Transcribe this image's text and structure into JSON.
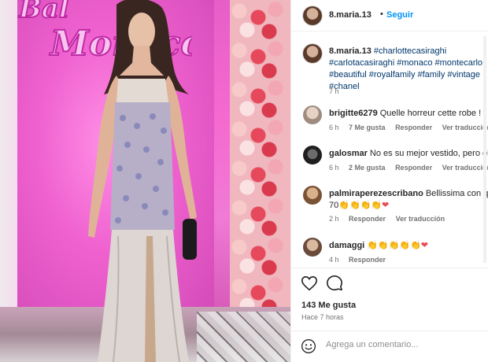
{
  "photo": {
    "sign_text": "Bal de la Rose Monaco",
    "alt": ""
  },
  "header": {
    "username": "8.maria.13",
    "separator": "•",
    "follow_label": "Seguir"
  },
  "caption": {
    "username": "8.maria.13",
    "hashtags": "#charlottecasiraghi #carlotacasiraghi #monaco #montecarlo #beautiful #royalfamily #family #vintage #chanel",
    "time": "7 h"
  },
  "comments": [
    {
      "username": "brigitte6279",
      "text": "Quelle horreur cette robe !",
      "time": "6 h",
      "likes": "7 Me gusta",
      "reply": "Responder",
      "translate": "Ver traducción"
    },
    {
      "username": "galosmar",
      "text": "No es su mejor vestido, pero el",
      "time": "6 h",
      "likes": "2 Me gusta",
      "reply": "Responder",
      "translate": "Ver traducción"
    },
    {
      "username": "palmiraperezescribano",
      "text": "Bellissima con que",
      "text2": "70",
      "time": "2 h",
      "likes": "",
      "reply": "Responder",
      "translate": "Ver traducción"
    },
    {
      "username": "damaggi",
      "text": "",
      "time": "4 h",
      "likes": "",
      "reply": "Responder",
      "translate": ""
    }
  ],
  "actions": {
    "like_icon": "heart-icon",
    "comment_icon": "comment-icon",
    "likes_count": "143 Me gusta",
    "posted_ago": "Hace 7 horas"
  },
  "composer": {
    "emoji_icon": "emoji-icon",
    "placeholder": "Agrega un comentario..."
  },
  "colors": {
    "link": "#0095f6",
    "hashtag": "#00376b",
    "heart": "#ed4956",
    "muted": "#737373"
  }
}
